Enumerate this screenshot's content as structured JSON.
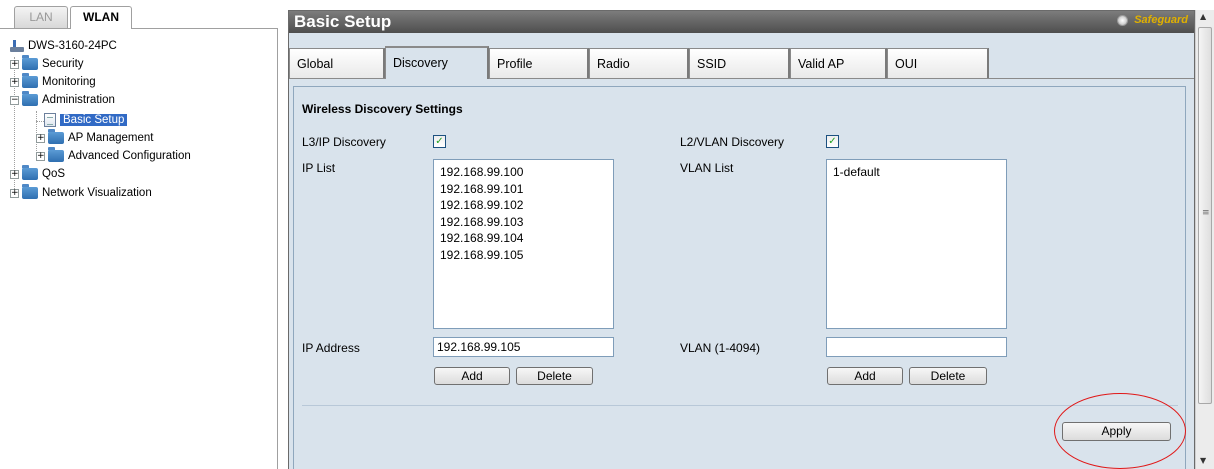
{
  "left_tabs": {
    "lan": "LAN",
    "wlan": "WLAN"
  },
  "tree": {
    "root": "DWS-3160-24PC",
    "security": "Security",
    "monitoring": "Monitoring",
    "administration": "Administration",
    "basic_setup": "Basic Setup",
    "ap_management": "AP Management",
    "advanced_configuration": "Advanced Configuration",
    "qos": "QoS",
    "network_visualization": "Network Visualization",
    "expander_plus": "+",
    "expander_minus": "−"
  },
  "header": {
    "title": "Basic Setup",
    "safeguard": "Safeguard"
  },
  "tabs": [
    "Global",
    "Discovery",
    "Profile",
    "Radio",
    "SSID",
    "Valid AP",
    "OUI"
  ],
  "active_tab": "Discovery",
  "discovery": {
    "section_title": "Wireless Discovery Settings",
    "l3_label": "L3/IP Discovery",
    "l3_checked": true,
    "l2_label": "L2/VLAN Discovery",
    "l2_checked": true,
    "ip_list_label": "IP List",
    "ip_list": [
      "192.168.99.100",
      "192.168.99.101",
      "192.168.99.102",
      "192.168.99.103",
      "192.168.99.104",
      "192.168.99.105"
    ],
    "vlan_list_label": "VLAN List",
    "vlan_list": [
      "1-default"
    ],
    "ip_address_label": "IP Address",
    "ip_address_value": "192.168.99.105",
    "vlan_label": "VLAN (1-4094)",
    "vlan_value": "",
    "add_label": "Add",
    "delete_label": "Delete",
    "apply_label": "Apply",
    "check_mark": "✓"
  },
  "scrollbar": {
    "up": "▲",
    "down": "▼",
    "grip": "≡"
  },
  "colors": {
    "title_bar": "#5a5a5a",
    "panel_bg": "#d9e3ec",
    "selection": "#316ac5",
    "highlight_ring": "#e01818"
  }
}
